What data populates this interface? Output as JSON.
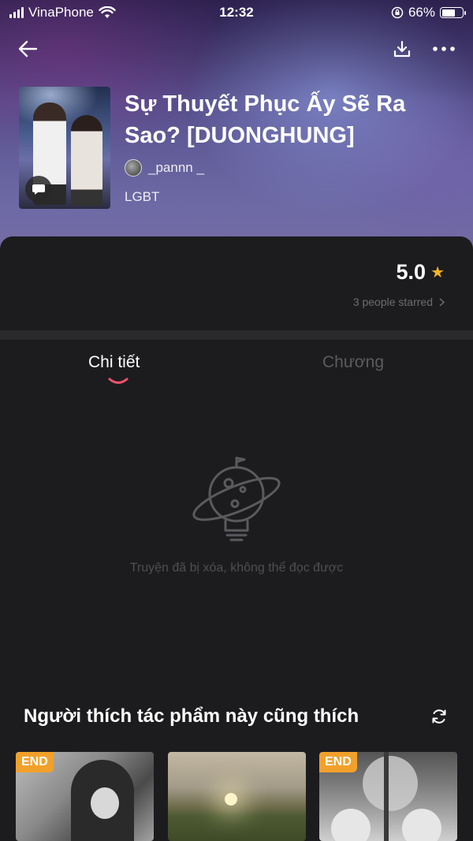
{
  "status_bar": {
    "carrier": "VinaPhone",
    "time": "12:32",
    "battery_percent": "66%",
    "battery_level": 0.66
  },
  "book": {
    "title": "Sự Thuyết Phục Ấy Sẽ Ra Sao? [DUONGHUNG]",
    "author": "_pannn _",
    "genre": "LGBT"
  },
  "rating": {
    "value": "5.0",
    "count_text": "3 people starred"
  },
  "tabs": [
    {
      "label": "Chi tiết",
      "active": true
    },
    {
      "label": "Chương",
      "active": false
    }
  ],
  "empty_state": {
    "message": "Truyện đã bị xóa, không thể đọc được"
  },
  "recommendations": {
    "title": "Người thích tác phẩm này cũng thích",
    "items": [
      {
        "badge": "END"
      },
      {
        "badge": ""
      },
      {
        "badge": "END"
      }
    ]
  },
  "colors": {
    "accent": "#f0506e",
    "star": "#f5b325",
    "end_badge": "#f1a12b",
    "background": "#1c1c1e"
  }
}
